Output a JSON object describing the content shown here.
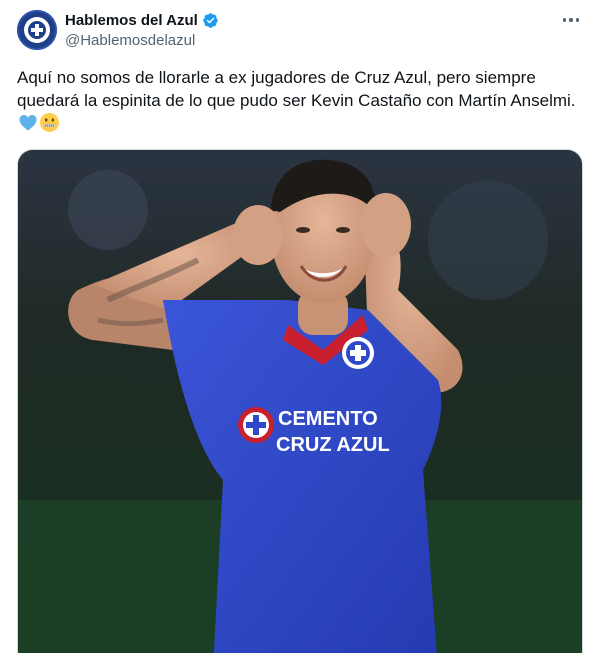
{
  "tweet": {
    "author": {
      "display_name": "Hablemos del Azul",
      "handle": "@Hablemosdelazul",
      "verified": true,
      "avatar_icon": "cross-logo-icon"
    },
    "text": "Aquí no somos de llorarle a ex jugadores de Cruz Azul, pero siempre quedará la espinita de lo que pudo ser Kevin Castaño con Martín Anselmi.",
    "emojis": [
      "blue-heart-icon",
      "zipper-mouth-face-icon"
    ],
    "media": {
      "jersey_sponsor_line1": "CEMENTO",
      "jersey_sponsor_line2": "CRUZ AZUL"
    }
  },
  "colors": {
    "verified_blue": "#1d9bf0",
    "handle_gray": "#536471",
    "jersey_blue": "#2f49c8",
    "jersey_red": "#c8202f"
  }
}
